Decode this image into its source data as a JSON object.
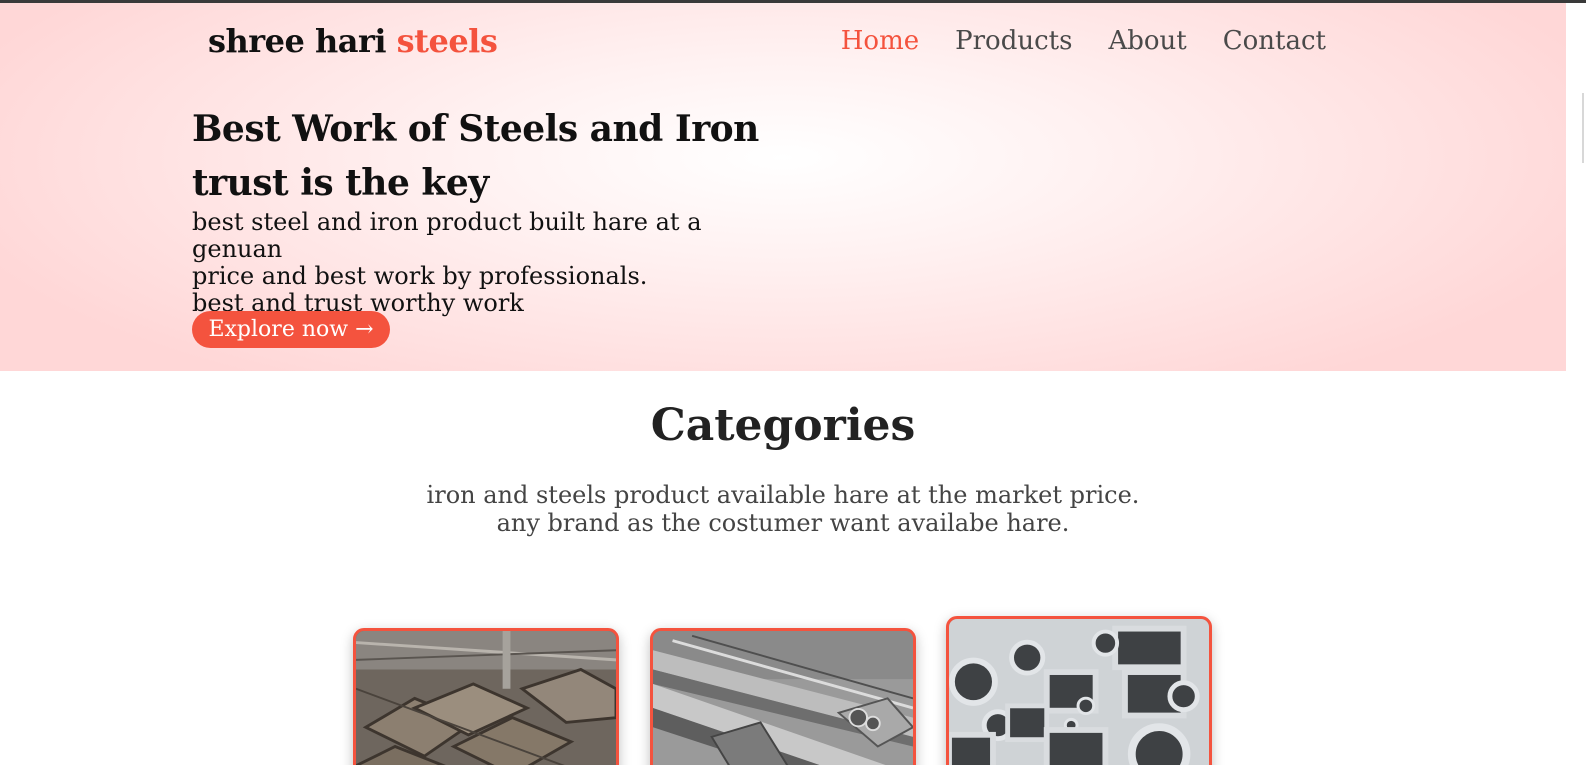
{
  "brand": {
    "name_main": "shree hari",
    "name_accent": "steels"
  },
  "nav": {
    "items": [
      {
        "label": "Home",
        "active": true
      },
      {
        "label": "Products",
        "active": false
      },
      {
        "label": "About",
        "active": false
      },
      {
        "label": "Contact",
        "active": false
      }
    ]
  },
  "hero": {
    "title_line1": "Best Work of Steels and Iron",
    "title_line2": "trust is the key",
    "desc_line1": "best steel and iron product built hare at a genuan",
    "desc_line2": "price and best work by professionals.",
    "desc_line3": "best and trust worthy work",
    "cta_label": "Explore now →"
  },
  "categories": {
    "title": "Categories",
    "desc_line1": "iron and steels product available hare at the market price.",
    "desc_line2": "any brand as the costumer want availabe hare.",
    "cards": [
      {
        "image": "rectangular-steel-tubes-photo"
      },
      {
        "image": "steel-angles-and-rods-photo"
      },
      {
        "image": "round-and-square-steel-pipes-photo"
      }
    ]
  },
  "colors": {
    "accent": "#f4533e",
    "hero_bg": "#ffd7d7",
    "text": "#111111"
  }
}
